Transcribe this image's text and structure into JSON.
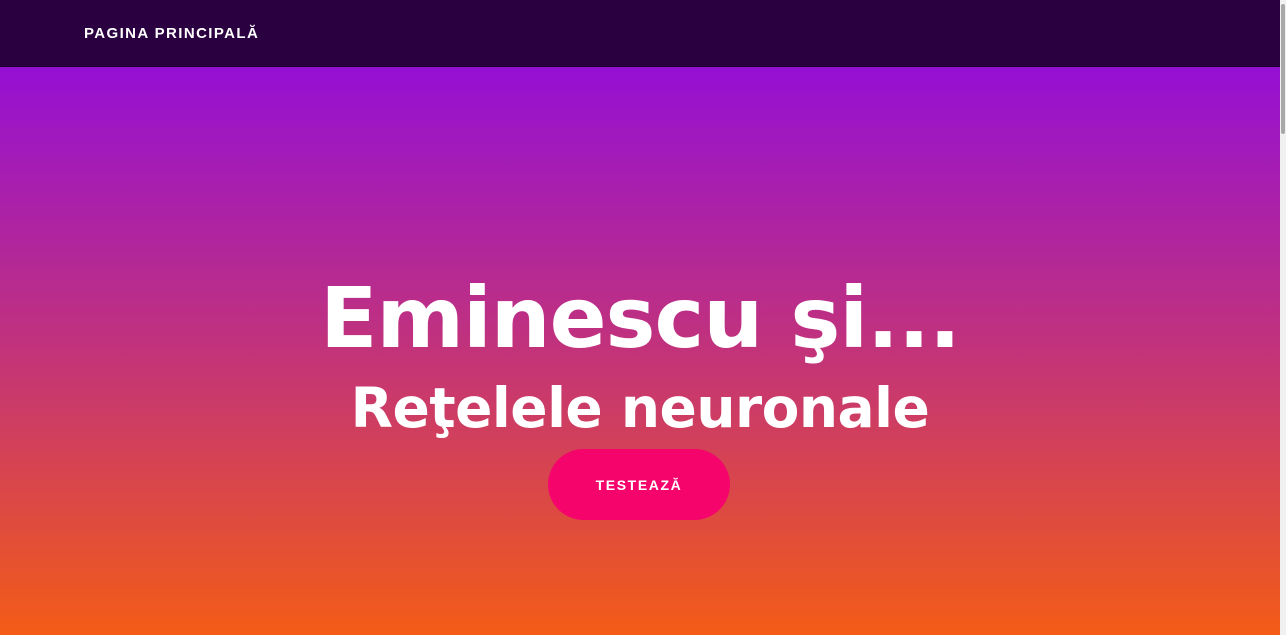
{
  "navbar": {
    "brand_label": "PAGINA PRINCIPALĂ",
    "background_color": "#2a0040"
  },
  "hero": {
    "title": "Eminescu şi...",
    "subtitle": "Reţelele neuronale",
    "cta_label": "TESTEAZĂ",
    "gradient_colors": [
      "#9510d4",
      "#c2337a",
      "#f35c16"
    ],
    "cta_color": "#f5046c"
  }
}
